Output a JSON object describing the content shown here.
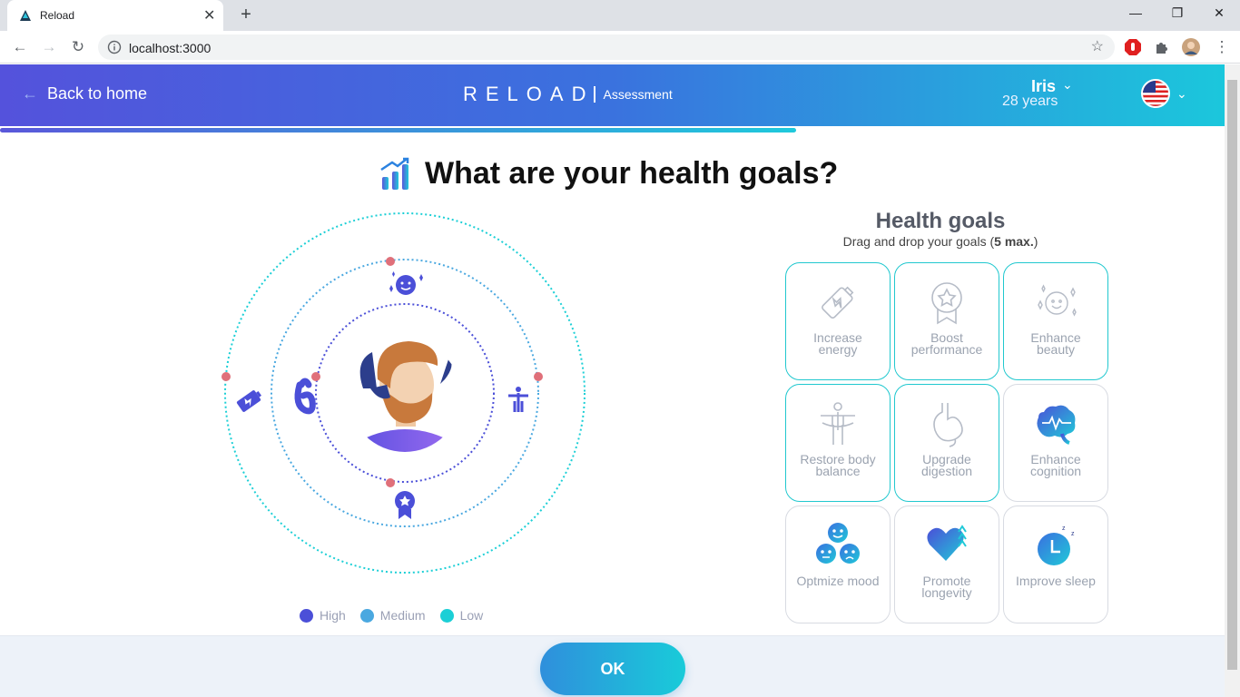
{
  "browser": {
    "tab_title": "Reload",
    "tab_close": "✕",
    "new_tab": "+",
    "url": "localhost:3000",
    "minimize": "—",
    "restore": "❐",
    "close": "✕"
  },
  "header": {
    "back_label": "Back to home",
    "logo_text": "RELOAD",
    "logo_sub": "Assessment",
    "user_name": "Iris",
    "user_age": "28 years",
    "language_flag_icon": "us-flag-icon"
  },
  "progress": {
    "fraction": 0.65
  },
  "question": {
    "title": "What are your health goals?",
    "icon": "chart-growth-icon"
  },
  "orbit": {
    "rings": [
      "High",
      "Medium",
      "Low"
    ],
    "placed_goals": [
      {
        "name": "Enhance beauty",
        "ring": "Medium",
        "icon": "beauty-face-icon"
      },
      {
        "name": "Increase energy",
        "ring": "Low",
        "icon": "battery-energy-icon"
      },
      {
        "name": "Upgrade digestion",
        "ring": "Medium",
        "icon": "stomach-icon"
      },
      {
        "name": "Restore body balance",
        "ring": "Medium",
        "icon": "body-balance-icon"
      },
      {
        "name": "Boost performance",
        "ring": "Medium",
        "icon": "medal-icon"
      }
    ]
  },
  "legend": {
    "items": [
      {
        "label": "High",
        "color": "#4b4fd8"
      },
      {
        "label": "Medium",
        "color": "#4aa8e0"
      },
      {
        "label": "Low",
        "color": "#1ccfd6"
      }
    ]
  },
  "goals_panel": {
    "title": "Health goals",
    "subtitle_prefix": "Drag and drop your goals (",
    "subtitle_bold": "5 max.",
    "subtitle_suffix": ")",
    "cards": [
      {
        "label": "Increase energy",
        "icon": "battery-energy-icon",
        "selected": true
      },
      {
        "label": "Boost performance",
        "icon": "medal-icon",
        "selected": true
      },
      {
        "label": "Enhance beauty",
        "icon": "beauty-face-icon",
        "selected": true
      },
      {
        "label": "Restore body balance",
        "icon": "body-balance-icon",
        "selected": true
      },
      {
        "label": "Upgrade digestion",
        "icon": "stomach-icon",
        "selected": true
      },
      {
        "label": "Enhance cognition",
        "icon": "brain-icon",
        "selected": false
      },
      {
        "label": "Optmize mood",
        "icon": "mood-faces-icon",
        "selected": false
      },
      {
        "label": "Promote longevity",
        "icon": "heart-icon",
        "selected": false
      },
      {
        "label": "Improve sleep",
        "icon": "sleep-clock-icon",
        "selected": false
      }
    ]
  },
  "footer": {
    "ok_label": "OK"
  },
  "colors": {
    "brand_start": "#5452dc",
    "brand_end": "#1bc7dc",
    "remove_badge": "#e0707a"
  }
}
